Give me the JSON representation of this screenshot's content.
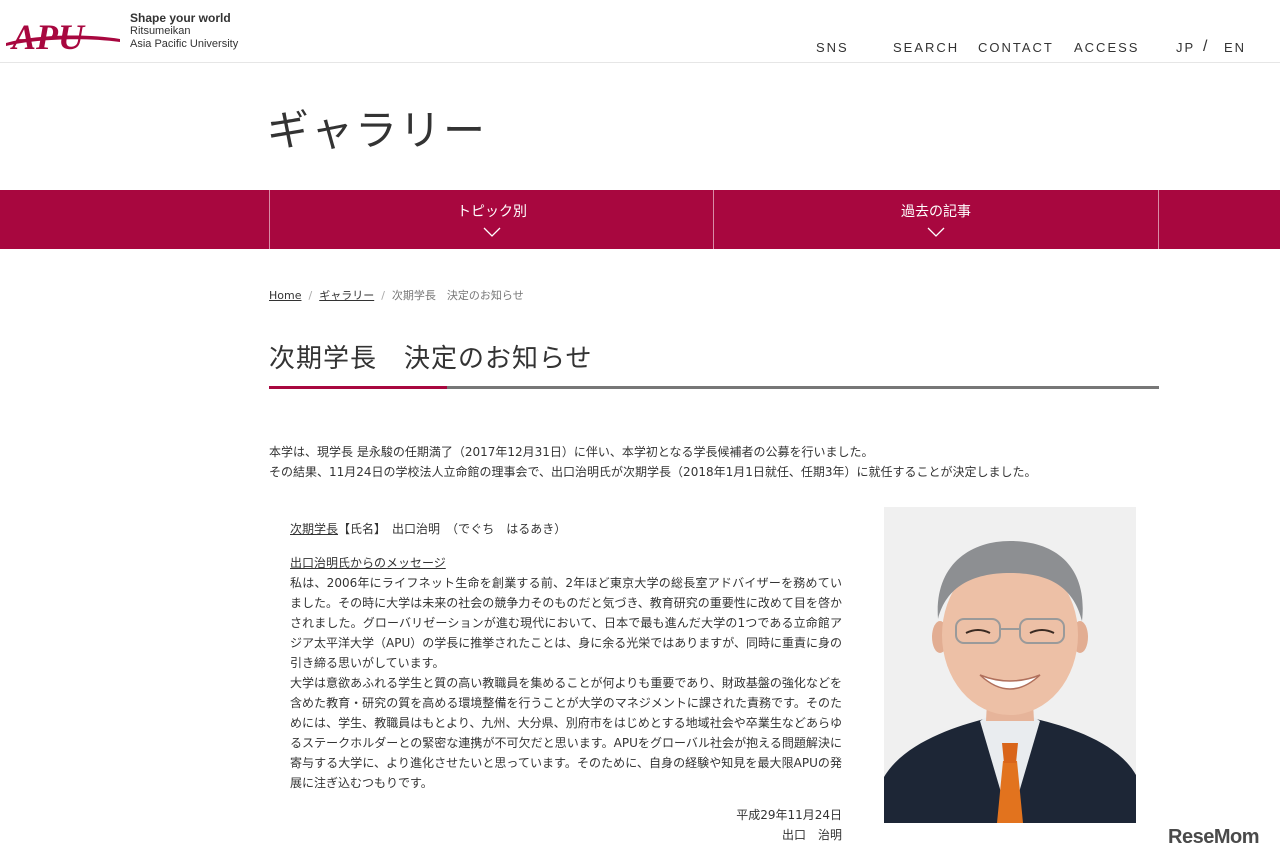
{
  "header": {
    "logo_text": "APU",
    "tagline": "Shape your world",
    "org_line1": "Ritsumeikan",
    "org_line2": "Asia Pacific University",
    "nav": {
      "sns": "SNS",
      "search": "SEARCH",
      "contact": "CONTACT",
      "access": "ACCESS"
    },
    "lang": {
      "jp": "JP",
      "slash": "/",
      "en": "EN"
    }
  },
  "page_title": "ギャラリー",
  "category_bar": {
    "topics": "トピック別",
    "archive": "過去の記事"
  },
  "breadcrumb": {
    "home": "Home",
    "sep": "/",
    "gallery": "ギャラリー",
    "current": "次期学長　決定のお知らせ"
  },
  "article": {
    "title": "次期学長　決定のお知らせ",
    "intro_line1": "本学は、現学長 是永駿の任期満了（2017年12月31日）に伴い、本学初となる学長候補者の公募を行いました。",
    "intro_line2": "その結果、11月24日の学校法人立命館の理事会で、出口治明氏が次期学長（2018年1月1日就任、任期3年）に就任することが決定しました。",
    "name_prefix_link": "次期学長",
    "name_rest": "【氏名】　出口治明　（でぐち　はるあき）",
    "message_heading": "出口治明氏からのメッセージ",
    "paragraph1": "私は、2006年にライフネット生命を創業する前、2年ほど東京大学の総長室アドバイザーを務めていました。その時に大学は未来の社会の競争力そのものだと気づき、教育研究の重要性に改めて目を啓かされました。グローバリゼーションが進む現代において、日本で最も進んだ大学の1つである立命館アジア太平洋大学（APU）の学長に推挙されたことは、身に余る光栄ではありますが、同時に重責に身の引き締る思いがしています。",
    "paragraph2": "大学は意欲あふれる学生と質の高い教職員を集めることが何よりも重要であり、財政基盤の強化などを含めた教育・研究の質を高める環境整備を行うことが大学のマネジメントに課された責務です。そのためには、学生、教職員はもとより、九州、大分県、別府市をはじめとする地域社会や卒業生などあらゆるステークホルダーとの緊密な連携が不可欠だと思います。APUをグローバル社会が抱える問題解決に寄与する大学に、より進化させたいと思っています。そのために、自身の経験や知見を最大限APUの発展に注ぎ込むつもりです。",
    "sign_date": "平成29年11月24日",
    "sign_name": "出口　治明"
  },
  "watermark": "ReseMom",
  "colors": {
    "brand": "#a8073f",
    "rule": "#777777"
  }
}
